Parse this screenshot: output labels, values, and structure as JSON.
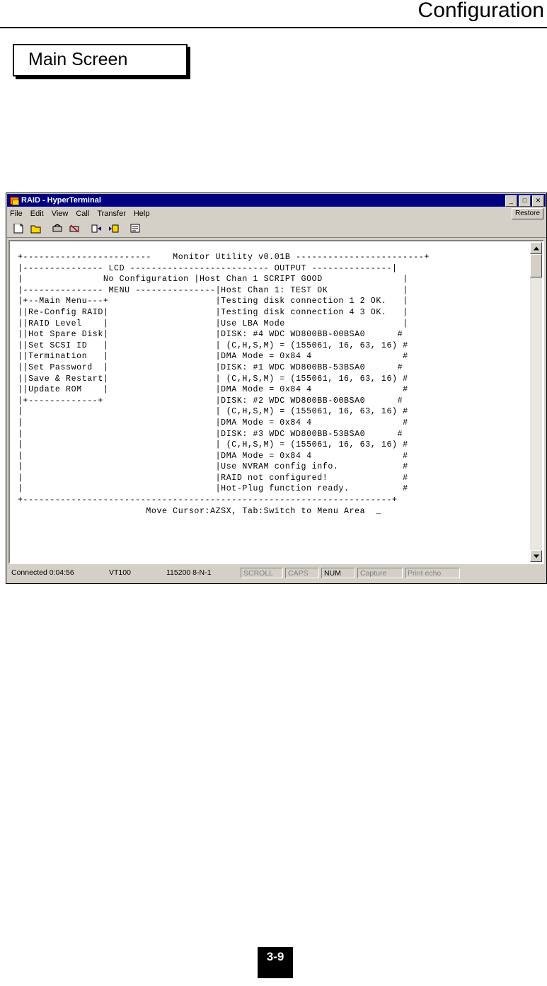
{
  "page": {
    "header_title": "Configuration",
    "section_label": "Main Screen",
    "page_number": "3-9"
  },
  "window": {
    "title": "RAID - HyperTerminal",
    "icon": "phone-modem-icon",
    "buttons": {
      "minimize": "_",
      "maximize": "□",
      "close": "✕"
    },
    "restore_label": "Restore",
    "menu": [
      "File",
      "Edit",
      "View",
      "Call",
      "Transfer",
      "Help"
    ],
    "toolbar_icons": [
      "new-connection-icon",
      "open-icon",
      "call-icon",
      "disconnect-icon",
      "send-file-icon",
      "receive-file-icon",
      "properties-icon"
    ]
  },
  "terminal": {
    "content": "+------------------------    Monitor Utility v0.01B ------------------------+\n|--------------- LCD -------------------------- OUTPUT ---------------|\n|               No Configuration |Host Chan 1 SCRIPT GOOD               |\n|--------------- MENU ---------------|Host Chan 1: TEST OK              |\n|+--Main Menu---+                    |Testing disk connection 1 2 OK.   |\n||Re-Config RAID|                    |Testing disk connection 4 3 OK.   |\n||RAID Level    |                    |Use LBA Mode                      |\n||Hot Spare Disk|                    |DISK: #4 WDC WD800BB-00BSA0      #\n||Set SCSI ID   |                    | (C,H,S,M) = (155061, 16, 63, 16) #\n||Termination   |                    |DMA Mode = 0x84 4                 #\n||Set Password  |                    |DISK: #1 WDC WD800BB-53BSA0      #\n||Save & Restart|                    | (C,H,S,M) = (155061, 16, 63, 16) #\n||Update ROM    |                    |DMA Mode = 0x84 4                 #\n|+-------------+                     |DISK: #2 WDC WD800BB-00BSA0      #\n|                                    | (C,H,S,M) = (155061, 16, 63, 16) #\n|                                    |DMA Mode = 0x84 4                 #\n|                                    |DISK: #3 WDC WD800BB-53BSA0      #\n|                                    | (C,H,S,M) = (155061, 16, 63, 16) #\n|                                    |DMA Mode = 0x84 4                 #\n|                                    |Use NVRAM config info.            #\n|                                    |RAID not configured!              #\n|                                    |Hot-Plug function ready.          #\n+---------------------------------------------------------------------+\n                        Move Cursor:AZSX, Tab:Switch to Menu Area  _",
    "lines": [
      "+------------------------    Monitor Utility v0.01B ------------------------+",
      "|--------------- LCD --------------------------- OUTPUT ----------------|",
      "|               No Configuration |Host Chan 1 SCRIPT GOOD               |",
      "|--------------- MENU ---------------|Host Chan 1: TEST OK              |",
      "|+--Main Menu---+                    |Testing disk connection 1 2 OK.   |",
      "||Re-Config RAID|                    |Testing disk connection 4 3 OK.   |",
      "||RAID Level    |                    |Use LBA Mode                      |",
      "||Hot Spare Disk|                    |DISK: #4 WDC WD800BB-00BSA0       #",
      "||Set SCSI ID   |                    | (C,H,S,M) = (155061, 16, 63, 16) #",
      "||Termination   |                    |DMA Mode = 0x84 4                 #",
      "||Set Password  |                    |DISK: #1 WDC WD800BB-53BSA0       #",
      "||Save & Restart|                    | (C,H,S,M) = (155061, 16, 63, 16) #",
      "||Update ROM    |                    |DMA Mode = 0x84 4                 #",
      "|+-------------+                     |DISK: #2 WDC WD800BB-00BSA0       #",
      "|                                    | (C,H,S,M) = (155061, 16, 63, 16) #",
      "|                                    |DMA Mode = 0x84 4                 #",
      "|                                    |DISK: #3 WDC WD800BB-53BSA0       #",
      "|                                    | (C,H,S,M) = (155061, 16, 63, 16) #",
      "|                                    |DMA Mode = 0x84 4                 #",
      "|                                    |Use NVRAM config info.            #",
      "|                                    |RAID not configured!              #",
      "|                                    |Hot-Plug function ready.          #",
      "+---------------------------------------------------------------------+",
      "                        Move Cursor:AZSX, Tab:Switch to Menu Area  _"
    ],
    "highlighted_menu_item": "Re-Config RAID"
  },
  "status_bar": {
    "connected": "Connected 0:04:56",
    "emulation": "VT100",
    "line_settings": "115200 8-N-1",
    "scroll": "SCROLL",
    "caps": "CAPS",
    "num": "NUM",
    "capture": "Capture",
    "print_echo": "Print echo"
  }
}
